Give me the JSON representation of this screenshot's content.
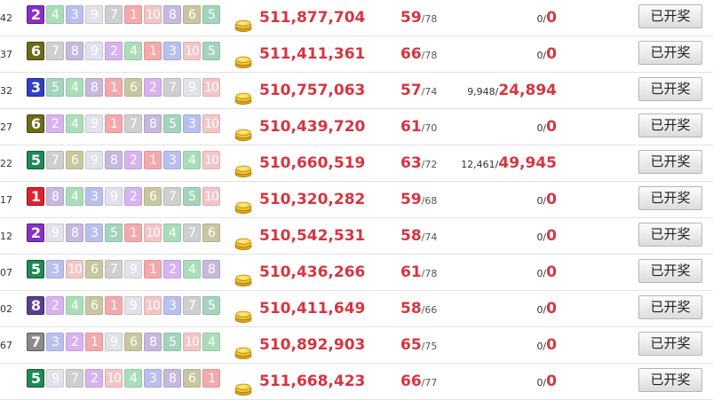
{
  "ball_colors": {
    "1": "#e0212b",
    "2": "#8a2fc9",
    "3": "#2f3fc9",
    "4": "#22b24c",
    "5": "#1f8a55",
    "6": "#6f6a16",
    "7": "#8a8a8a",
    "8": "#5a3f8e",
    "9": "#b7b7c7",
    "10": "#e88a8e"
  },
  "ball_colors_faded": {
    "1": "#f4a9ad",
    "2": "#d7b3ef",
    "3": "#b9bfee",
    "4": "#a9deb9",
    "5": "#a3d4bc",
    "6": "#c9c7a0",
    "7": "#cfcfcf",
    "8": "#c6b9dd",
    "9": "#e2e2ea",
    "10": "#f4c5c7"
  },
  "rows": [
    {
      "issue": "42",
      "balls": [
        "2",
        "4",
        "3",
        "9",
        "7",
        "1",
        "10",
        "8",
        "6",
        "5"
      ],
      "pool": "511,877,704",
      "count": "59",
      "count_total": "/78",
      "prize_small": "0/",
      "prize_big": "0",
      "button": "已开奖"
    },
    {
      "issue": "37",
      "balls": [
        "6",
        "7",
        "8",
        "9",
        "2",
        "4",
        "1",
        "3",
        "10",
        "5"
      ],
      "pool": "511,411,361",
      "count": "66",
      "count_total": "/78",
      "prize_small": "0/",
      "prize_big": "0",
      "button": "已开奖"
    },
    {
      "issue": "32",
      "balls": [
        "3",
        "5",
        "4",
        "8",
        "1",
        "6",
        "2",
        "7",
        "9",
        "10"
      ],
      "pool": "510,757,063",
      "count": "57",
      "count_total": "/74",
      "prize_small": "9,948/",
      "prize_big": "24,894",
      "button": "已开奖"
    },
    {
      "issue": "27",
      "balls": [
        "6",
        "2",
        "4",
        "9",
        "1",
        "7",
        "8",
        "5",
        "3",
        "10"
      ],
      "pool": "510,439,720",
      "count": "61",
      "count_total": "/70",
      "prize_small": "0/",
      "prize_big": "0",
      "button": "已开奖"
    },
    {
      "issue": "22",
      "balls": [
        "5",
        "7",
        "6",
        "9",
        "8",
        "2",
        "1",
        "3",
        "4",
        "10"
      ],
      "pool": "510,660,519",
      "count": "63",
      "count_total": "/72",
      "prize_small": "12,461/",
      "prize_big": "49,945",
      "button": "已开奖"
    },
    {
      "issue": "17",
      "balls": [
        "1",
        "8",
        "4",
        "3",
        "9",
        "2",
        "6",
        "7",
        "5",
        "10"
      ],
      "pool": "510,320,282",
      "count": "59",
      "count_total": "/68",
      "prize_small": "0/",
      "prize_big": "0",
      "button": "已开奖"
    },
    {
      "issue": "12",
      "balls": [
        "2",
        "9",
        "8",
        "3",
        "5",
        "1",
        "10",
        "4",
        "7",
        "6"
      ],
      "pool": "510,542,531",
      "count": "58",
      "count_total": "/74",
      "prize_small": "0/",
      "prize_big": "0",
      "button": "已开奖"
    },
    {
      "issue": "07",
      "balls": [
        "5",
        "3",
        "10",
        "6",
        "7",
        "9",
        "1",
        "2",
        "4",
        "8"
      ],
      "pool": "510,436,266",
      "count": "61",
      "count_total": "/78",
      "prize_small": "0/",
      "prize_big": "0",
      "button": "已开奖"
    },
    {
      "issue": "02",
      "balls": [
        "8",
        "2",
        "4",
        "6",
        "1",
        "9",
        "10",
        "3",
        "7",
        "5"
      ],
      "pool": "510,411,649",
      "count": "58",
      "count_total": "/66",
      "prize_small": "0/",
      "prize_big": "0",
      "button": "已开奖"
    },
    {
      "issue": "67",
      "balls": [
        "7",
        "3",
        "2",
        "1",
        "9",
        "6",
        "8",
        "5",
        "10",
        "4"
      ],
      "pool": "510,892,903",
      "count": "65",
      "count_total": "/75",
      "prize_small": "0/",
      "prize_big": "0",
      "button": "已开奖"
    },
    {
      "issue": "",
      "balls": [
        "5",
        "9",
        "7",
        "2",
        "10",
        "4",
        "3",
        "8",
        "6",
        "1"
      ],
      "pool": "511,668,423",
      "count": "66",
      "count_total": "/77",
      "prize_small": "0/",
      "prize_big": "0",
      "button": "已开奖"
    }
  ]
}
